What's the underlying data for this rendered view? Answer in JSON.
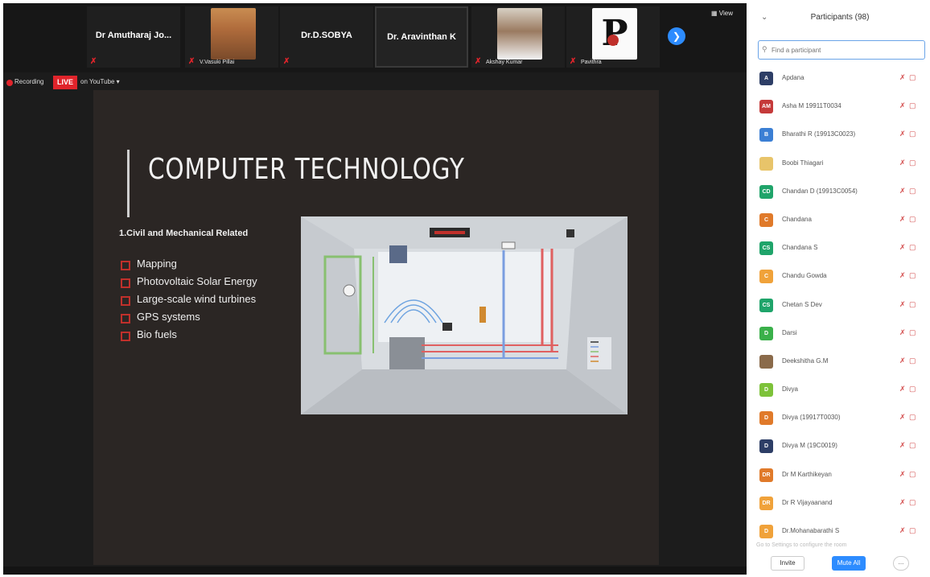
{
  "strip": {
    "tiles": [
      {
        "name": "Dr Amutharaj Jo..."
      },
      {
        "caption": "V.Vasuki Pillai"
      },
      {
        "name": "Dr.D.SOBYA"
      },
      {
        "name": "Dr. Aravinthan K"
      },
      {
        "caption": "Akshay Kumar"
      },
      {
        "caption": "Pavithra"
      }
    ],
    "view_label": "View"
  },
  "status": {
    "recording_label": "Recording",
    "live_label": "LIVE",
    "live_on": "on YouTube"
  },
  "slide": {
    "title": "COMPUTER TECHNOLOGY",
    "subtitle": "1.Civil and Mechanical Related",
    "bullets": [
      "Mapping",
      "Photovoltaic Solar Energy",
      "Large-scale wind turbines",
      "GPS systems",
      "Bio fuels"
    ]
  },
  "panel": {
    "title": "Participants (98)",
    "search_placeholder": "Find a participant",
    "participants": [
      {
        "initials": "A",
        "name": "Apdana",
        "color": "#2d3e66"
      },
      {
        "initials": "AM",
        "name": "Asha M 19911T0034",
        "color": "#c53a3a"
      },
      {
        "initials": "B",
        "name": "Bharathi R (19913C0023)",
        "color": "#3b7fd4"
      },
      {
        "initials": "",
        "name": "Boobi Thiagari",
        "color": "#e8c46a"
      },
      {
        "initials": "CD",
        "name": "Chandan D (19913C0054)",
        "color": "#1fa46a"
      },
      {
        "initials": "C",
        "name": "Chandana",
        "color": "#e07a2a"
      },
      {
        "initials": "CS",
        "name": "Chandana S",
        "color": "#1fa46a"
      },
      {
        "initials": "C",
        "name": "Chandu Gowda",
        "color": "#f0a23a"
      },
      {
        "initials": "CS",
        "name": "Chetan S Dev",
        "color": "#1fa46a"
      },
      {
        "initials": "D",
        "name": "Darsi",
        "color": "#3ab04a"
      },
      {
        "initials": "",
        "name": "Deekshitha G.M",
        "color": "#8a6a4a"
      },
      {
        "initials": "D",
        "name": "Divya",
        "color": "#7dc23a"
      },
      {
        "initials": "D",
        "name": "Divya (19917T0030)",
        "color": "#e07a2a"
      },
      {
        "initials": "D",
        "name": "Divya M (19C0019)",
        "color": "#2d3e66"
      },
      {
        "initials": "DR",
        "name": "Dr M Karthikeyan",
        "color": "#e07a2a"
      },
      {
        "initials": "DR",
        "name": "Dr R Vijayaanand",
        "color": "#f0a23a"
      },
      {
        "initials": "D",
        "name": "Dr.Mohanabarathi S",
        "color": "#f0a23a"
      }
    ],
    "footer_note": "Go to Settings to configure the room",
    "invite_label": "Invite",
    "mute_all_label": "Mute All",
    "more_label": "..."
  }
}
